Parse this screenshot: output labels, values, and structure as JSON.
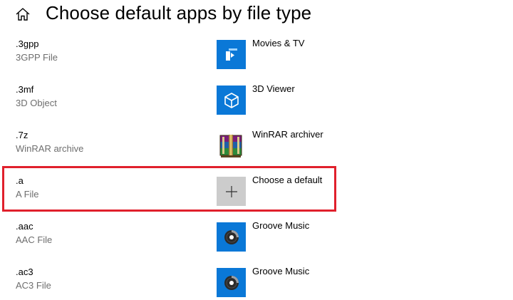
{
  "header": {
    "title": "Choose default apps by file type",
    "home_icon": "home-icon"
  },
  "rows": [
    {
      "extension": ".3gpp",
      "file_type": "3GPP File",
      "app": "Movies & TV",
      "app_icon": "movies-tv-icon"
    },
    {
      "extension": ".3mf",
      "file_type": "3D Object",
      "app": "3D Viewer",
      "app_icon": "3d-viewer-icon"
    },
    {
      "extension": ".7z",
      "file_type": "WinRAR archive",
      "app": "WinRAR archiver",
      "app_icon": "winrar-icon"
    },
    {
      "extension": ".a",
      "file_type": "A File",
      "app": "Choose a default",
      "app_icon": "plus-icon",
      "highlighted": true
    },
    {
      "extension": ".aac",
      "file_type": "AAC File",
      "app": "Groove Music",
      "app_icon": "groove-music-icon"
    },
    {
      "extension": ".ac3",
      "file_type": "AC3 File",
      "app": "Groove Music",
      "app_icon": "groove-music-icon"
    }
  ],
  "colors": {
    "tile_blue": "#0a78d7",
    "tile_gray": "#cccccc",
    "highlight_border": "#e0202c",
    "secondary_text": "#6e6e6e"
  }
}
